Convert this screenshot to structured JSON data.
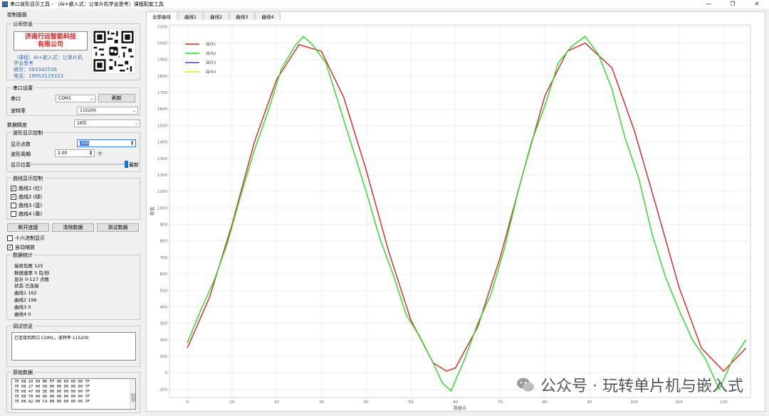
{
  "window": {
    "title": "串口波形显示工具 - （AI+嵌入式：让单片机学会思考）课程配套工具",
    "minimize": "—",
    "restore": "❐",
    "close": "✕"
  },
  "control_panel": {
    "title": "控制面板",
    "company": {
      "group_title": "公司信息",
      "name_line1": "济南行远智能科技",
      "name_line2": "有限公司",
      "course_line1": "（课程）AI+嵌入式：让单片机",
      "course_line2": "学会思考",
      "wechat": "微信：593342536",
      "phone": "电话：19953129323"
    },
    "serial": {
      "group_title": "串口设置",
      "port_label": "串口",
      "port_value": "COM1",
      "refresh_button": "刷新",
      "baud_label": "波特率",
      "baud_value": "115200"
    },
    "data_width": {
      "label": "数据精度",
      "value": "16位"
    },
    "wave_control": {
      "group_title": "波形显示控制",
      "points_label": "显示点数",
      "points_value": "100",
      "period_label": "波形周期",
      "period_value": "2.00",
      "period_unit": "个",
      "position_label": "显示位置",
      "position_value_label": "最新",
      "position_level": 1.0
    },
    "curve_control": {
      "group_title": "曲线显示控制",
      "curves": [
        {
          "label": "曲线1 (红)",
          "checked": true
        },
        {
          "label": "曲线2 (绿)",
          "checked": true
        },
        {
          "label": "曲线3 (蓝)",
          "checked": false
        },
        {
          "label": "曲线4 (黄)",
          "checked": false
        }
      ]
    },
    "buttons": {
      "disconnect": "断开连接",
      "clear": "清除数据",
      "test": "测试数据"
    },
    "hex_display": {
      "label": "十六进制显示",
      "checked": false
    },
    "auto_scale": {
      "label": "自动缩放",
      "checked": true
    },
    "stats": {
      "group_title": "数据统计",
      "lines": [
        "接收包数  125",
        "数据速率  5 包/秒",
        "显示  0-127 点数",
        "状态  已连接",
        "曲线1  162",
        "曲线2  196",
        "曲线3  0",
        "曲线4  0"
      ]
    },
    "debug": {
      "group_title": "调试信息",
      "text": "已连接到串口 COM1，波特率 115200"
    },
    "raw": {
      "group_title": "原始数据",
      "lines": [
        "7E 08 10 00 B6 FF 00 00 00 00 7F",
        "7E 08 27 00 09 00 00 00 00 00 7F",
        "7E 08 47 00 5E 00 00 00 00 00 7F",
        "7E 08 70 00 66 00 00 00 00 00 7F",
        "7E 08 A2 00 C4 00 00 00 00 00 7F"
      ]
    }
  },
  "tabs": [
    "全部曲线",
    "曲线1",
    "曲线2",
    "曲线3",
    "曲线4"
  ],
  "watermark": "公众号 · 玩转单片机与嵌入式",
  "chart_data": {
    "type": "line",
    "xlabel": "数据点",
    "ylabel": "数值",
    "xlim": [
      -4,
      126
    ],
    "ylim": [
      -150,
      2110
    ],
    "xticks": [
      0,
      10,
      20,
      30,
      40,
      50,
      60,
      70,
      80,
      90,
      100,
      110,
      120
    ],
    "yticks": [
      -100,
      0,
      100,
      200,
      300,
      400,
      500,
      600,
      700,
      800,
      900,
      1000,
      1100,
      1200,
      1300,
      1400,
      1500,
      1600,
      1700,
      1800,
      1900,
      2000,
      2100
    ],
    "grid": true,
    "legend_position": "top-left",
    "series": [
      {
        "name": "曲线1",
        "color": "#e02020",
        "x": [
          0,
          5,
          10,
          15,
          20,
          25,
          30,
          35,
          40,
          45,
          50,
          55,
          58,
          60,
          65,
          70,
          75,
          80,
          85,
          89,
          95,
          100,
          105,
          110,
          115,
          120,
          125
        ],
        "y": [
          150,
          460,
          900,
          1400,
          1780,
          1990,
          1950,
          1670,
          1230,
          740,
          320,
          60,
          10,
          30,
          280,
          700,
          1200,
          1680,
          1950,
          2000,
          1850,
          1470,
          1000,
          520,
          150,
          10,
          150
        ]
      },
      {
        "name": "曲线2",
        "color": "#22dd22",
        "x": [
          0,
          3,
          6,
          9,
          12,
          15,
          18,
          21,
          24,
          26,
          28,
          31,
          34,
          37,
          40,
          43,
          46,
          49,
          52,
          55,
          57,
          59,
          62,
          65,
          68,
          71,
          74,
          77,
          80,
          83,
          86,
          89,
          92,
          95,
          98,
          101,
          104,
          107,
          110,
          113,
          116,
          119,
          122,
          125
        ],
        "y": [
          180,
          380,
          560,
          790,
          1080,
          1350,
          1580,
          1840,
          1980,
          2040,
          1990,
          1880,
          1620,
          1360,
          1100,
          820,
          600,
          350,
          220,
          60,
          -60,
          -110,
          80,
          300,
          480,
          760,
          1100,
          1400,
          1620,
          1880,
          1980,
          2040,
          1930,
          1720,
          1420,
          1180,
          840,
          580,
          380,
          200,
          80,
          -100,
          80,
          200
        ]
      },
      {
        "name": "曲线3",
        "color": "#3344ee",
        "x": [],
        "y": []
      },
      {
        "name": "曲线4",
        "color": "#f5e400",
        "x": [],
        "y": []
      }
    ]
  }
}
